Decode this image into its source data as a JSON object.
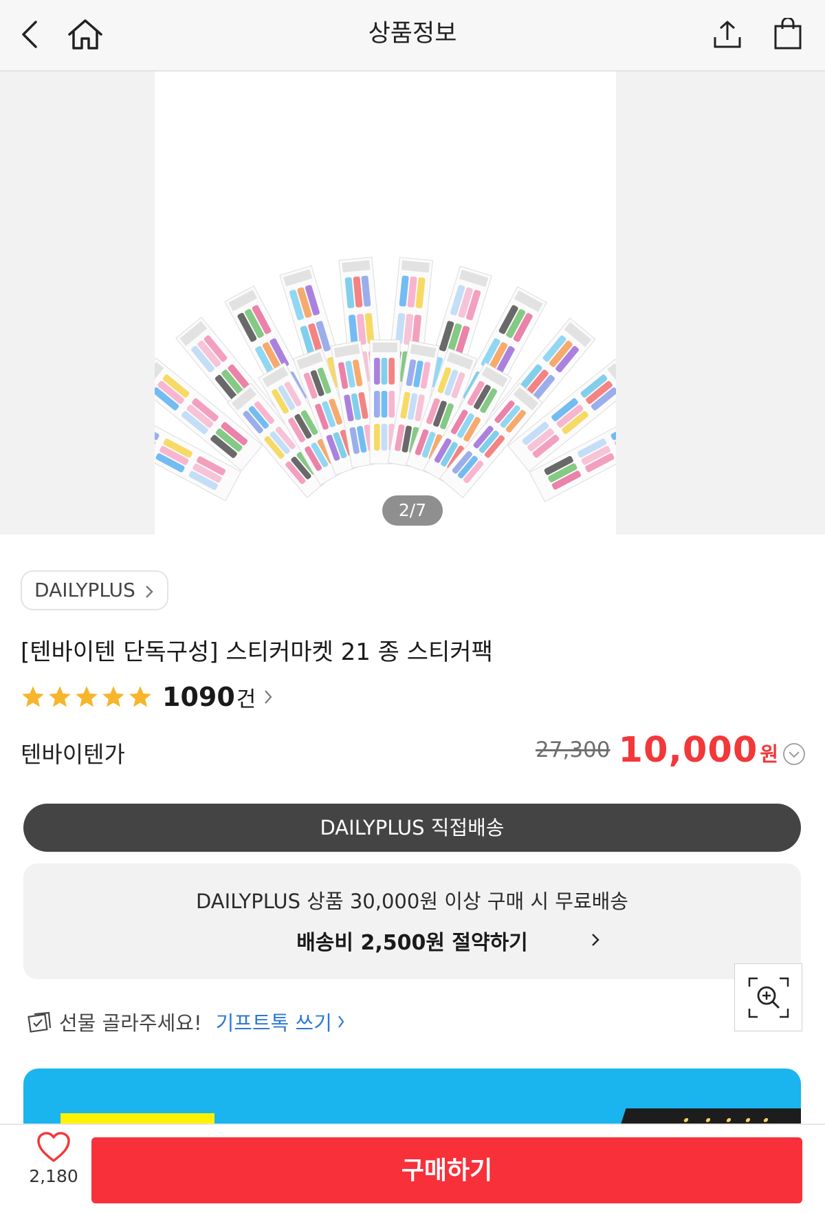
{
  "header": {
    "title": "상품정보",
    "icons": [
      "back-icon",
      "home-icon",
      "share-icon",
      "shopping-bag-icon"
    ]
  },
  "gallery": {
    "page_indicator": "2/7",
    "image": "sticker-sheets-fan-photo"
  },
  "product": {
    "brand": "DAILYPLUS",
    "title": "[텐바이텐 단독구성] 스티커마켓 21 종 스티커팩",
    "rating": {
      "stars": 5,
      "review_count": "1090",
      "review_unit": "건"
    },
    "discount_label": "텐바이텐가",
    "original_price": "27,300",
    "sale_price": "10,000",
    "currency_unit": "원"
  },
  "shipping": {
    "pill_label": "DAILYPLUS 직접배송",
    "free_shipping_text": "DAILYPLUS 상품 30,000원 이상 구매 시 무료배송",
    "save_link_text": "배송비 2,500원 절약하기"
  },
  "gift": {
    "prompt": "선물 골라주세요!",
    "link": "기프트톡 쓰기"
  },
  "bottom_bar": {
    "like_count": "2,180",
    "buy_label": "구매하기"
  },
  "colors": {
    "accent_red": "#f2383a",
    "buy_button": "#f7303a",
    "star": "#f7b52c",
    "link_blue": "#2b77d8",
    "ship_pill": "#444444",
    "promo_blue": "#1ab4ee"
  }
}
